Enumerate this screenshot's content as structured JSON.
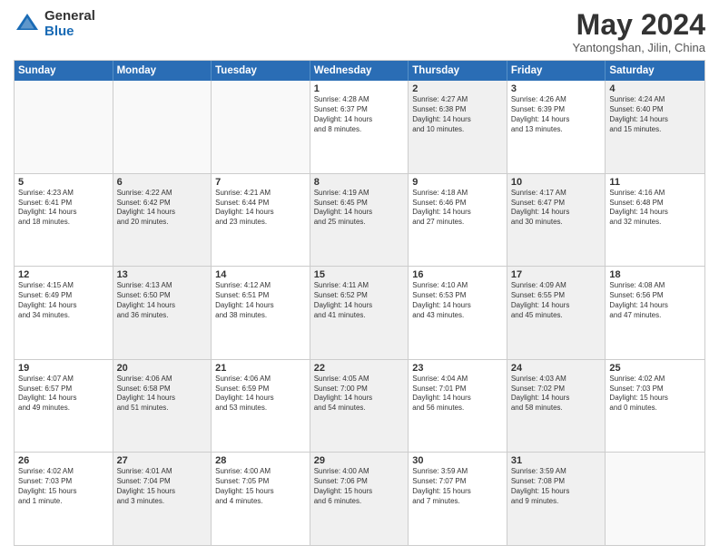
{
  "logo": {
    "general": "General",
    "blue": "Blue"
  },
  "title": "May 2024",
  "subtitle": "Yantongshan, Jilin, China",
  "header_days": [
    "Sunday",
    "Monday",
    "Tuesday",
    "Wednesday",
    "Thursday",
    "Friday",
    "Saturday"
  ],
  "weeks": [
    [
      {
        "day": "",
        "text": "",
        "shaded": false,
        "empty": true
      },
      {
        "day": "",
        "text": "",
        "shaded": false,
        "empty": true
      },
      {
        "day": "",
        "text": "",
        "shaded": false,
        "empty": true
      },
      {
        "day": "1",
        "text": "Sunrise: 4:28 AM\nSunset: 6:37 PM\nDaylight: 14 hours\nand 8 minutes.",
        "shaded": false,
        "empty": false
      },
      {
        "day": "2",
        "text": "Sunrise: 4:27 AM\nSunset: 6:38 PM\nDaylight: 14 hours\nand 10 minutes.",
        "shaded": true,
        "empty": false
      },
      {
        "day": "3",
        "text": "Sunrise: 4:26 AM\nSunset: 6:39 PM\nDaylight: 14 hours\nand 13 minutes.",
        "shaded": false,
        "empty": false
      },
      {
        "day": "4",
        "text": "Sunrise: 4:24 AM\nSunset: 6:40 PM\nDaylight: 14 hours\nand 15 minutes.",
        "shaded": true,
        "empty": false
      }
    ],
    [
      {
        "day": "5",
        "text": "Sunrise: 4:23 AM\nSunset: 6:41 PM\nDaylight: 14 hours\nand 18 minutes.",
        "shaded": false,
        "empty": false
      },
      {
        "day": "6",
        "text": "Sunrise: 4:22 AM\nSunset: 6:42 PM\nDaylight: 14 hours\nand 20 minutes.",
        "shaded": true,
        "empty": false
      },
      {
        "day": "7",
        "text": "Sunrise: 4:21 AM\nSunset: 6:44 PM\nDaylight: 14 hours\nand 23 minutes.",
        "shaded": false,
        "empty": false
      },
      {
        "day": "8",
        "text": "Sunrise: 4:19 AM\nSunset: 6:45 PM\nDaylight: 14 hours\nand 25 minutes.",
        "shaded": true,
        "empty": false
      },
      {
        "day": "9",
        "text": "Sunrise: 4:18 AM\nSunset: 6:46 PM\nDaylight: 14 hours\nand 27 minutes.",
        "shaded": false,
        "empty": false
      },
      {
        "day": "10",
        "text": "Sunrise: 4:17 AM\nSunset: 6:47 PM\nDaylight: 14 hours\nand 30 minutes.",
        "shaded": true,
        "empty": false
      },
      {
        "day": "11",
        "text": "Sunrise: 4:16 AM\nSunset: 6:48 PM\nDaylight: 14 hours\nand 32 minutes.",
        "shaded": false,
        "empty": false
      }
    ],
    [
      {
        "day": "12",
        "text": "Sunrise: 4:15 AM\nSunset: 6:49 PM\nDaylight: 14 hours\nand 34 minutes.",
        "shaded": false,
        "empty": false
      },
      {
        "day": "13",
        "text": "Sunrise: 4:13 AM\nSunset: 6:50 PM\nDaylight: 14 hours\nand 36 minutes.",
        "shaded": true,
        "empty": false
      },
      {
        "day": "14",
        "text": "Sunrise: 4:12 AM\nSunset: 6:51 PM\nDaylight: 14 hours\nand 38 minutes.",
        "shaded": false,
        "empty": false
      },
      {
        "day": "15",
        "text": "Sunrise: 4:11 AM\nSunset: 6:52 PM\nDaylight: 14 hours\nand 41 minutes.",
        "shaded": true,
        "empty": false
      },
      {
        "day": "16",
        "text": "Sunrise: 4:10 AM\nSunset: 6:53 PM\nDaylight: 14 hours\nand 43 minutes.",
        "shaded": false,
        "empty": false
      },
      {
        "day": "17",
        "text": "Sunrise: 4:09 AM\nSunset: 6:55 PM\nDaylight: 14 hours\nand 45 minutes.",
        "shaded": true,
        "empty": false
      },
      {
        "day": "18",
        "text": "Sunrise: 4:08 AM\nSunset: 6:56 PM\nDaylight: 14 hours\nand 47 minutes.",
        "shaded": false,
        "empty": false
      }
    ],
    [
      {
        "day": "19",
        "text": "Sunrise: 4:07 AM\nSunset: 6:57 PM\nDaylight: 14 hours\nand 49 minutes.",
        "shaded": false,
        "empty": false
      },
      {
        "day": "20",
        "text": "Sunrise: 4:06 AM\nSunset: 6:58 PM\nDaylight: 14 hours\nand 51 minutes.",
        "shaded": true,
        "empty": false
      },
      {
        "day": "21",
        "text": "Sunrise: 4:06 AM\nSunset: 6:59 PM\nDaylight: 14 hours\nand 53 minutes.",
        "shaded": false,
        "empty": false
      },
      {
        "day": "22",
        "text": "Sunrise: 4:05 AM\nSunset: 7:00 PM\nDaylight: 14 hours\nand 54 minutes.",
        "shaded": true,
        "empty": false
      },
      {
        "day": "23",
        "text": "Sunrise: 4:04 AM\nSunset: 7:01 PM\nDaylight: 14 hours\nand 56 minutes.",
        "shaded": false,
        "empty": false
      },
      {
        "day": "24",
        "text": "Sunrise: 4:03 AM\nSunset: 7:02 PM\nDaylight: 14 hours\nand 58 minutes.",
        "shaded": true,
        "empty": false
      },
      {
        "day": "25",
        "text": "Sunrise: 4:02 AM\nSunset: 7:03 PM\nDaylight: 15 hours\nand 0 minutes.",
        "shaded": false,
        "empty": false
      }
    ],
    [
      {
        "day": "26",
        "text": "Sunrise: 4:02 AM\nSunset: 7:03 PM\nDaylight: 15 hours\nand 1 minute.",
        "shaded": false,
        "empty": false
      },
      {
        "day": "27",
        "text": "Sunrise: 4:01 AM\nSunset: 7:04 PM\nDaylight: 15 hours\nand 3 minutes.",
        "shaded": true,
        "empty": false
      },
      {
        "day": "28",
        "text": "Sunrise: 4:00 AM\nSunset: 7:05 PM\nDaylight: 15 hours\nand 4 minutes.",
        "shaded": false,
        "empty": false
      },
      {
        "day": "29",
        "text": "Sunrise: 4:00 AM\nSunset: 7:06 PM\nDaylight: 15 hours\nand 6 minutes.",
        "shaded": true,
        "empty": false
      },
      {
        "day": "30",
        "text": "Sunrise: 3:59 AM\nSunset: 7:07 PM\nDaylight: 15 hours\nand 7 minutes.",
        "shaded": false,
        "empty": false
      },
      {
        "day": "31",
        "text": "Sunrise: 3:59 AM\nSunset: 7:08 PM\nDaylight: 15 hours\nand 9 minutes.",
        "shaded": true,
        "empty": false
      },
      {
        "day": "",
        "text": "",
        "shaded": false,
        "empty": true
      }
    ]
  ]
}
